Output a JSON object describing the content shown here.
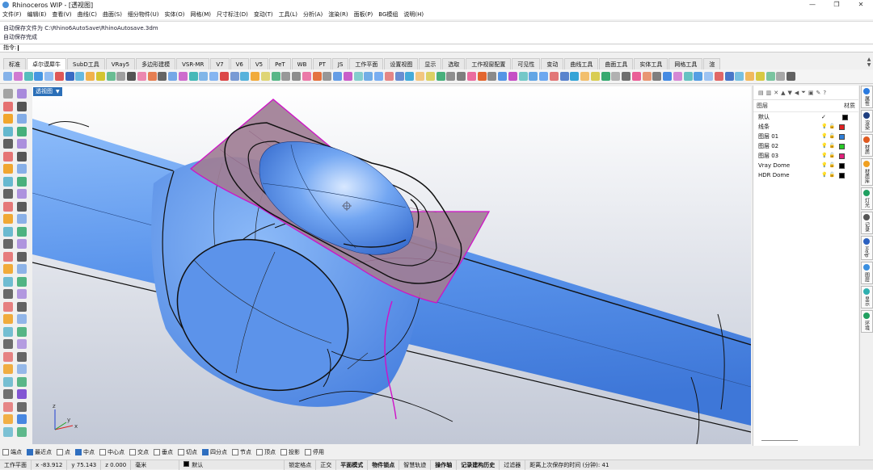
{
  "window": {
    "title": "Rhinoceros WIP - [透视图]",
    "minimize": "—",
    "maximize": "❐",
    "close": "✕"
  },
  "menu": [
    "文件(F)",
    "编辑(E)",
    "查看(V)",
    "曲线(C)",
    "曲面(S)",
    "细分物件(U)",
    "实体(O)",
    "网格(M)",
    "尺寸标注(D)",
    "变动(T)",
    "工具(L)",
    "分析(A)",
    "渲染(R)",
    "面板(P)",
    "BG模组",
    "说明(H)"
  ],
  "command_history": [
    "自动保存文件为 C:\\Rhino6AutoSave\\RhinoAutosave.3dm",
    "自动保存完成"
  ],
  "command_prompt": "指令:",
  "tabs": [
    "标准",
    "卓尔谟犀牛",
    "SubD工具",
    "VRay5",
    "多边形建模",
    "VSR-MR",
    "V7",
    "V6",
    "V5",
    "PeT",
    "WB",
    "PT",
    "JS",
    "工作平面",
    "设置视图",
    "显示",
    "选取",
    "工作视窗配置",
    "可见性",
    "变动",
    "曲线工具",
    "曲面工具",
    "实体工具",
    "网格工具",
    "渲"
  ],
  "active_tab": 1,
  "viewport": {
    "label": "透视图",
    "axis_x": "x",
    "axis_y": "y",
    "axis_z": "z"
  },
  "layers_panel": {
    "title": "图层",
    "material_header": "材质",
    "layers": [
      {
        "name": "默认",
        "current": "✓",
        "color": "#000000"
      },
      {
        "name": "线条",
        "color": "#e02020"
      },
      {
        "name": "图层 01",
        "color": "#2f7fd8"
      },
      {
        "name": "图层 02",
        "color": "#28c828"
      },
      {
        "name": "图层 03",
        "color": "#e0207a"
      },
      {
        "name": "Vray Dome",
        "color": "#000000"
      },
      {
        "name": "HDR Dome",
        "color": "#000000"
      }
    ]
  },
  "side_tabs": [
    "属性",
    "渲染",
    "材质",
    "材质库",
    "灯光",
    "记录",
    "Help",
    "图层",
    "显示",
    "环境"
  ],
  "osnap": {
    "items": [
      {
        "label": "端点",
        "on": false
      },
      {
        "label": "最近点",
        "on": true
      },
      {
        "label": "点",
        "on": false
      },
      {
        "label": "中点",
        "on": true
      },
      {
        "label": "中心点",
        "on": false
      },
      {
        "label": "交点",
        "on": false
      },
      {
        "label": "垂点",
        "on": false
      },
      {
        "label": "切点",
        "on": false
      },
      {
        "label": "四分点",
        "on": true
      },
      {
        "label": "节点",
        "on": false
      },
      {
        "label": "顶点",
        "on": false
      },
      {
        "label": "投影",
        "on": false
      },
      {
        "label": "停用",
        "on": false
      }
    ]
  },
  "status": {
    "cplane": "工作平面",
    "x": "x -83.912",
    "y": "y 75.143",
    "z": "z 0.000",
    "unit": "毫米",
    "layer": "默认",
    "lock_grid": "锁定格点",
    "ortho": "正交",
    "planar": "平面模式",
    "osnap": "物件锁点",
    "smart_track": "智慧轨迹",
    "gumball": "操作轴",
    "history": "记录建构历史",
    "filter": "过滤器",
    "autosave": "距离上次保存的时间 (分钟): 41"
  },
  "colors": {
    "accent": "#2b6fb8",
    "surface": "#5f98ee",
    "patch": "#a07e95",
    "magenta": "#d010c8"
  }
}
